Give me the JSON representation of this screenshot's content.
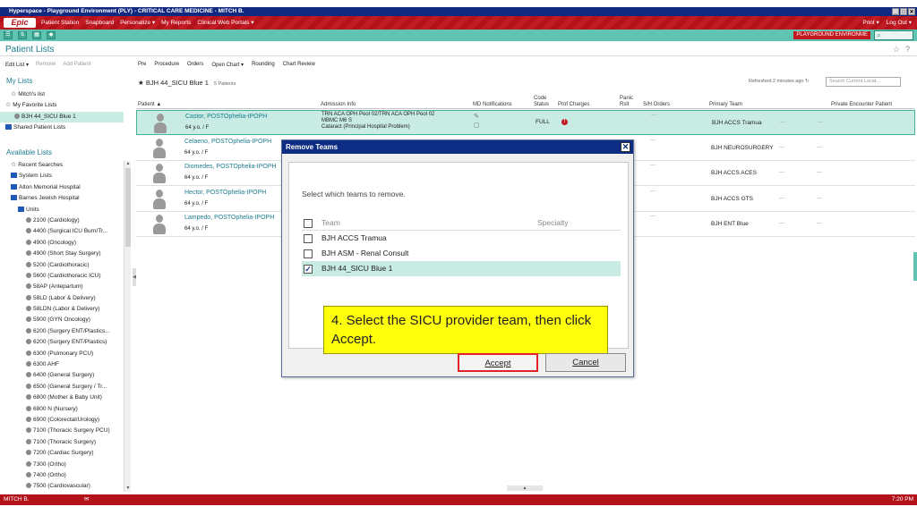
{
  "window_title": "Hyperspace - Playground Environment (PLY) - CRITICAL CARE MEDICINE - MITCH B.",
  "epic": {
    "logo": "Epic",
    "menu": [
      "Patient Station",
      "Snapboard",
      "Personalize ▾",
      "My Reports",
      "Clinical Web Portals ▾"
    ],
    "right": [
      "Print ▾",
      "Log Out ▾"
    ]
  },
  "env_badge": "PLAYGROUND ENVIRONME",
  "page_title": "Patient Lists",
  "left_toolbar": {
    "edit_list": "Edit List ▾",
    "remove": "Remove",
    "add_patient": "Add Patient"
  },
  "right_toolbar": [
    "Pre",
    "Procedure",
    "Orders",
    "Open Chart ▾",
    "Rounding",
    "Chart Review"
  ],
  "sidebar": {
    "my_lists_header": "My Lists",
    "my_lists": [
      "Mitch's list",
      "My Favorite Lists",
      "BJH 44_SICU Blue 1",
      "Shared Patient Lists"
    ],
    "available_header": "Available Lists",
    "available": [
      "Recent Searches",
      "System Lists",
      "Alton Memorial Hospital",
      "Barnes Jewish Hospital",
      "Units",
      "2100 (Cardiology)",
      "4400 (Surgical ICU Burn/Tr...",
      "4900 (Oncology)",
      "4900 (Short Stay Surgery)",
      "5200 (Cardiothoracic)",
      "5600 (Cardiothoracic ICU)",
      "58AP (Antepartum)",
      "58LD (Labor & Delivery)",
      "58LDN (Labor & Delivery)",
      "5900 (GYN Oncology)",
      "6200 (Surgery ENT/Plastics...",
      "6200 (Surgery ENT/Plastics)",
      "6300 (Pulmonary PCU)",
      "6300 AHF",
      "6400 (General Surgery)",
      "6500 (General Surgery / Tr...",
      "6800 (Mother & Baby Unit)",
      "6800 N (Nursery)",
      "6900 (Colorectal/Urology)",
      "7100 (Thoracic Surgery PCU)",
      "7100 (Thoracic Surgery)",
      "7200 (Cardiac Surgery)",
      "7300 (Ortho)",
      "7400 (Ortho)",
      "7500 (Cardiovascular)"
    ]
  },
  "list": {
    "title": "BJH 44_SICU Blue 1",
    "count": "5 Patients",
    "refreshed": "Refreshed 2 minutes ago",
    "search_placeholder": "Search Current Locat..."
  },
  "columns": {
    "patient": "Patient ▲",
    "admission": "Admission Info",
    "md": "MD Notifications",
    "code": "Code Status",
    "prof": "Prof Charges",
    "panic": "Panic Rslt",
    "sh": "S/H Orders",
    "primary": "Primary Team",
    "private": "Private Encounter Patient"
  },
  "patients": [
    {
      "name": "Castor, POSTOphelia-IPOPH",
      "age": "64 y.o. / F",
      "adm1": "TRN ACA OPH Pool 02/TRN ACA OPH Pool 02",
      "adm2": "MBMC M6 S",
      "adm3": "Cataract (Principal Hospital Problem)",
      "code": "FULL",
      "team": "BJH ACCS Tramua"
    },
    {
      "name": "Celaeno, POSTOphelia-IPOPH",
      "age": "64 y.o. / F",
      "adm1": "",
      "adm2": "",
      "adm3": "",
      "code": "",
      "team": "BJH NEUROSURGERY"
    },
    {
      "name": "Diomedes, POSTOphelia-IPOPH",
      "age": "64 y.o. / F",
      "adm1": "",
      "adm2": "",
      "adm3": "",
      "code": "",
      "team": "BJH ACCS ACES"
    },
    {
      "name": "Hector, POSTOphelia-IPOPH",
      "age": "64 y.o. / F",
      "adm1": "",
      "adm2": "",
      "adm3": "",
      "code": "",
      "team": "BJH ACCS GTS"
    },
    {
      "name": "Lampedo, POSTOphelia-IPOPH",
      "age": "64 y.o. / F",
      "adm1": "",
      "adm2": "",
      "adm3": "",
      "code": "",
      "team": "BJH ENT Blue"
    }
  ],
  "dialog": {
    "title": "Remove Teams",
    "prompt": "Select which teams to remove.",
    "col_team": "Team",
    "col_specialty": "Specialty",
    "teams": [
      {
        "name": "BJH ACCS Tramua",
        "checked": false
      },
      {
        "name": "BJH ASM - Renal Consult",
        "checked": false
      },
      {
        "name": "BJH 44_SICU Blue 1",
        "checked": true
      }
    ],
    "callout": "4. Select the SICU provider team, then click Accept.",
    "accept": "Accept",
    "cancel": "Cancel"
  },
  "status": {
    "user": "MITCH B.",
    "time": "7:20 PM"
  }
}
